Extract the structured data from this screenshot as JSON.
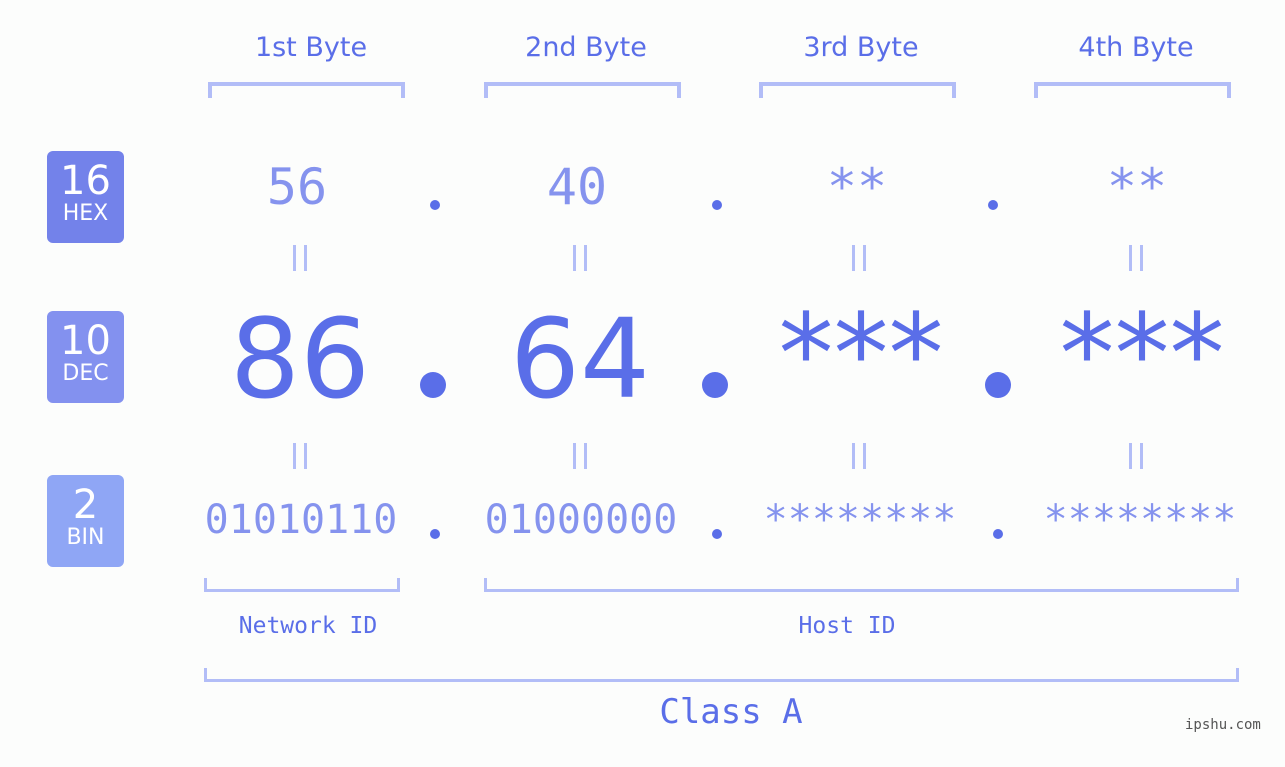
{
  "bytes": [
    {
      "header": "1st Byte",
      "hex": "56",
      "dec": "86",
      "bin": "01010110"
    },
    {
      "header": "2nd Byte",
      "hex": "40",
      "dec": "64",
      "bin": "01000000"
    },
    {
      "header": "3rd Byte",
      "hex": "**",
      "dec": "***",
      "bin": "********"
    },
    {
      "header": "4th Byte",
      "hex": "**",
      "dec": "***",
      "bin": "********"
    }
  ],
  "bases": {
    "hex": {
      "num": "16",
      "label": "HEX",
      "color": "#7382ea"
    },
    "dec": {
      "num": "10",
      "label": "DEC",
      "color": "#8391ef"
    },
    "bin": {
      "num": "2",
      "label": "BIN",
      "color": "#8fa6f5"
    }
  },
  "equals_symbol": "=",
  "network_id_label": "Network ID",
  "host_id_label": "Host ID",
  "class_label": "Class A",
  "watermark": "ipshu.com",
  "colors": {
    "accent": "#5a6ee8",
    "light": "#8593ee",
    "bracket": "#b2bdf7",
    "background": "#fcfdfc"
  }
}
